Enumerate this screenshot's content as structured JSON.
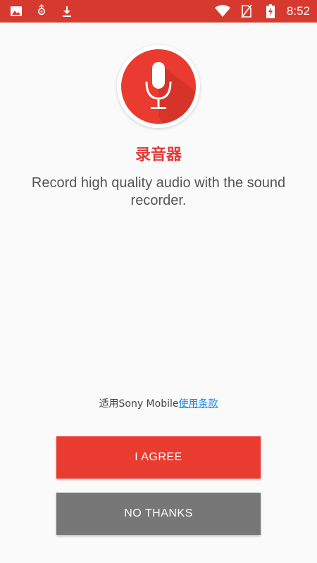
{
  "status_bar": {
    "time": "8:52",
    "icons": [
      "image-icon",
      "app-notification-icon",
      "download-icon",
      "wifi-icon",
      "no-sim-icon",
      "battery-charging-icon"
    ]
  },
  "app": {
    "title": "录音器",
    "description": "Record high quality audio with the sound recorder.",
    "logo_icon": "microphone-icon"
  },
  "terms": {
    "prefix": "适用Sony Mobile",
    "link": "使用条款"
  },
  "buttons": {
    "agree": "I AGREE",
    "no_thanks": "NO THANKS"
  },
  "colors": {
    "accent": "#e53935",
    "status_bar": "#d63a2f",
    "secondary_button": "#777777",
    "link": "#1e88e5"
  }
}
